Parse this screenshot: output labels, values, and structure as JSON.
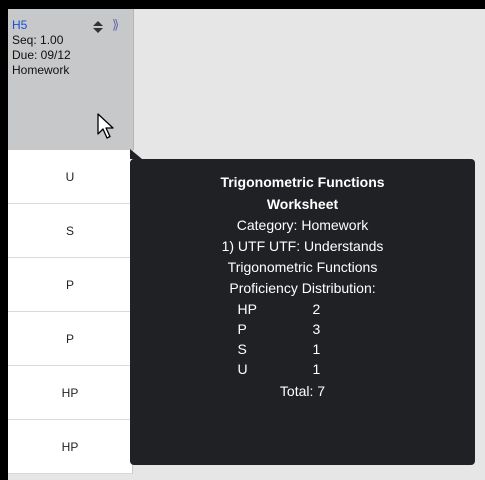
{
  "column_header": {
    "code": "H5",
    "seq": "Seq: 1.00",
    "due": "Due: 09/12",
    "category": "Homework"
  },
  "cells": [
    "U",
    "S",
    "P",
    "P",
    "HP",
    "HP"
  ],
  "tooltip": {
    "title_line1": "Trigonometric Functions",
    "title_line2": "Worksheet",
    "category": "Category: Homework",
    "standard_line1": "1) UTF UTF: Understands",
    "standard_line2": "Trigonometric Functions",
    "distribution_heading": "Proficiency Distribution:",
    "distribution": [
      {
        "level": "HP",
        "count": "2"
      },
      {
        "level": "P",
        "count": "3"
      },
      {
        "level": "S",
        "count": "1"
      },
      {
        "level": "U",
        "count": "1"
      }
    ],
    "total": "Total: 7"
  },
  "icons": {
    "sort": "sort-icon",
    "expand": "expand-icon",
    "cursor": "cursor-icon"
  }
}
